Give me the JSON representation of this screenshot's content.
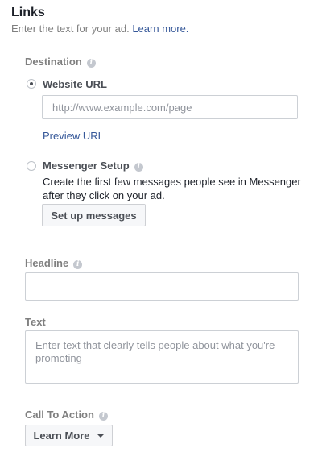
{
  "links": {
    "title": "Links",
    "subtitle": "Enter the text for your ad.",
    "learn_more": "Learn more."
  },
  "destination": {
    "label": "Destination",
    "website_url": {
      "label": "Website URL",
      "placeholder": "http://www.example.com/page",
      "value": "",
      "preview": "Preview URL",
      "selected": true
    },
    "messenger": {
      "label": "Messenger Setup",
      "description": "Create the first few messages people see in Messenger after they click on your ad.",
      "button": "Set up messages",
      "selected": false
    }
  },
  "headline": {
    "label": "Headline",
    "value": "",
    "placeholder": ""
  },
  "text": {
    "label": "Text",
    "value": "",
    "placeholder": "Enter text that clearly tells people about what you're promoting"
  },
  "cta": {
    "label": "Call To Action",
    "selected": "Learn More"
  },
  "icons": {
    "info": "info-icon",
    "dropdown": "caret-down-icon"
  },
  "colors": {
    "link": "#365899",
    "label": "#7f7f7f",
    "border": "#ccd0d5"
  }
}
